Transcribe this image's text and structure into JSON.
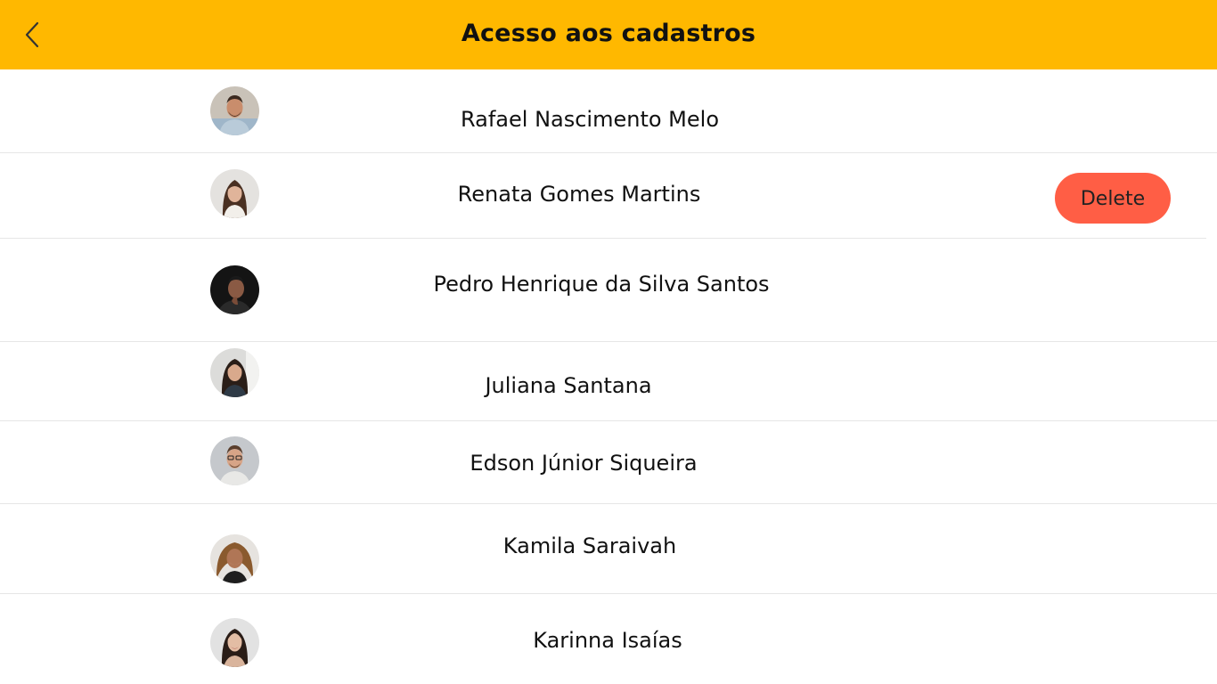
{
  "header": {
    "title": "Acesso aos cadastros",
    "back_icon": "chevron-left-icon",
    "background": "#FFB800"
  },
  "users": [
    {
      "name": "Rafael Nascimento Melo"
    },
    {
      "name": "Renata Gomes Martins",
      "delete_label": "Delete"
    },
    {
      "name": "Pedro Henrique da Silva Santos"
    },
    {
      "name": "Juliana Santana"
    },
    {
      "name": "Edson Júnior Siqueira"
    },
    {
      "name": "Kamila Saraivah"
    },
    {
      "name": "Karinna Isaías"
    }
  ],
  "colors": {
    "accent": "#FFB800",
    "delete": "#FF5E45"
  }
}
